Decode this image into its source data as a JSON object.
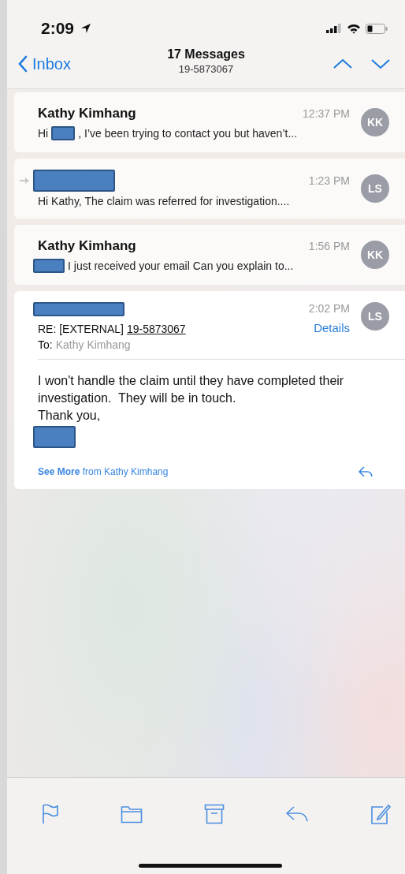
{
  "status_bar": {
    "time": "2:09"
  },
  "nav": {
    "back": "Inbox",
    "title": "17 Messages",
    "subtitle": "19-5873067"
  },
  "messages": [
    {
      "kind": "collapsed",
      "sender": {
        "kind": "text",
        "text": "Kathy Kimhang"
      },
      "forwarded": false,
      "time": "12:37 PM",
      "initials": "KK",
      "preview": [
        {
          "kind": "text",
          "text": "Hi"
        },
        {
          "kind": "redacted"
        },
        {
          "kind": "text",
          "text": ", I’ve been trying to contact you but haven’t..."
        }
      ]
    },
    {
      "kind": "collapsed",
      "sender": {
        "kind": "redacted"
      },
      "forwarded": true,
      "time": "1:23 PM",
      "initials": "LS",
      "preview": [
        {
          "kind": "text",
          "text": "Hi Kathy, The claim was referred for investigation...."
        }
      ]
    },
    {
      "kind": "collapsed",
      "sender": {
        "kind": "text",
        "text": "Kathy Kimhang"
      },
      "forwarded": false,
      "time": "1:56 PM",
      "initials": "KK",
      "preview": [
        {
          "kind": "redacted"
        },
        {
          "kind": "text",
          "text": "I just received your email Can you explain to..."
        }
      ]
    },
    {
      "kind": "expanded",
      "sender": {
        "kind": "redacted"
      },
      "time": "2:02 PM",
      "initials": "LS",
      "details": "Details",
      "subject": "RE: [EXTERNAL]",
      "subject_link": "19-5873067",
      "to_label": "To:",
      "to": "Kathy Kimhang",
      "body": [
        {
          "kind": "text",
          "text": "I won't handle the claim until they have completed their investigation.  They will be in touch."
        },
        {
          "kind": "text",
          "text": "Thank you,"
        },
        {
          "kind": "redacted"
        }
      ],
      "see_more": "**See More** from Kathy Kimhang"
    }
  ]
}
